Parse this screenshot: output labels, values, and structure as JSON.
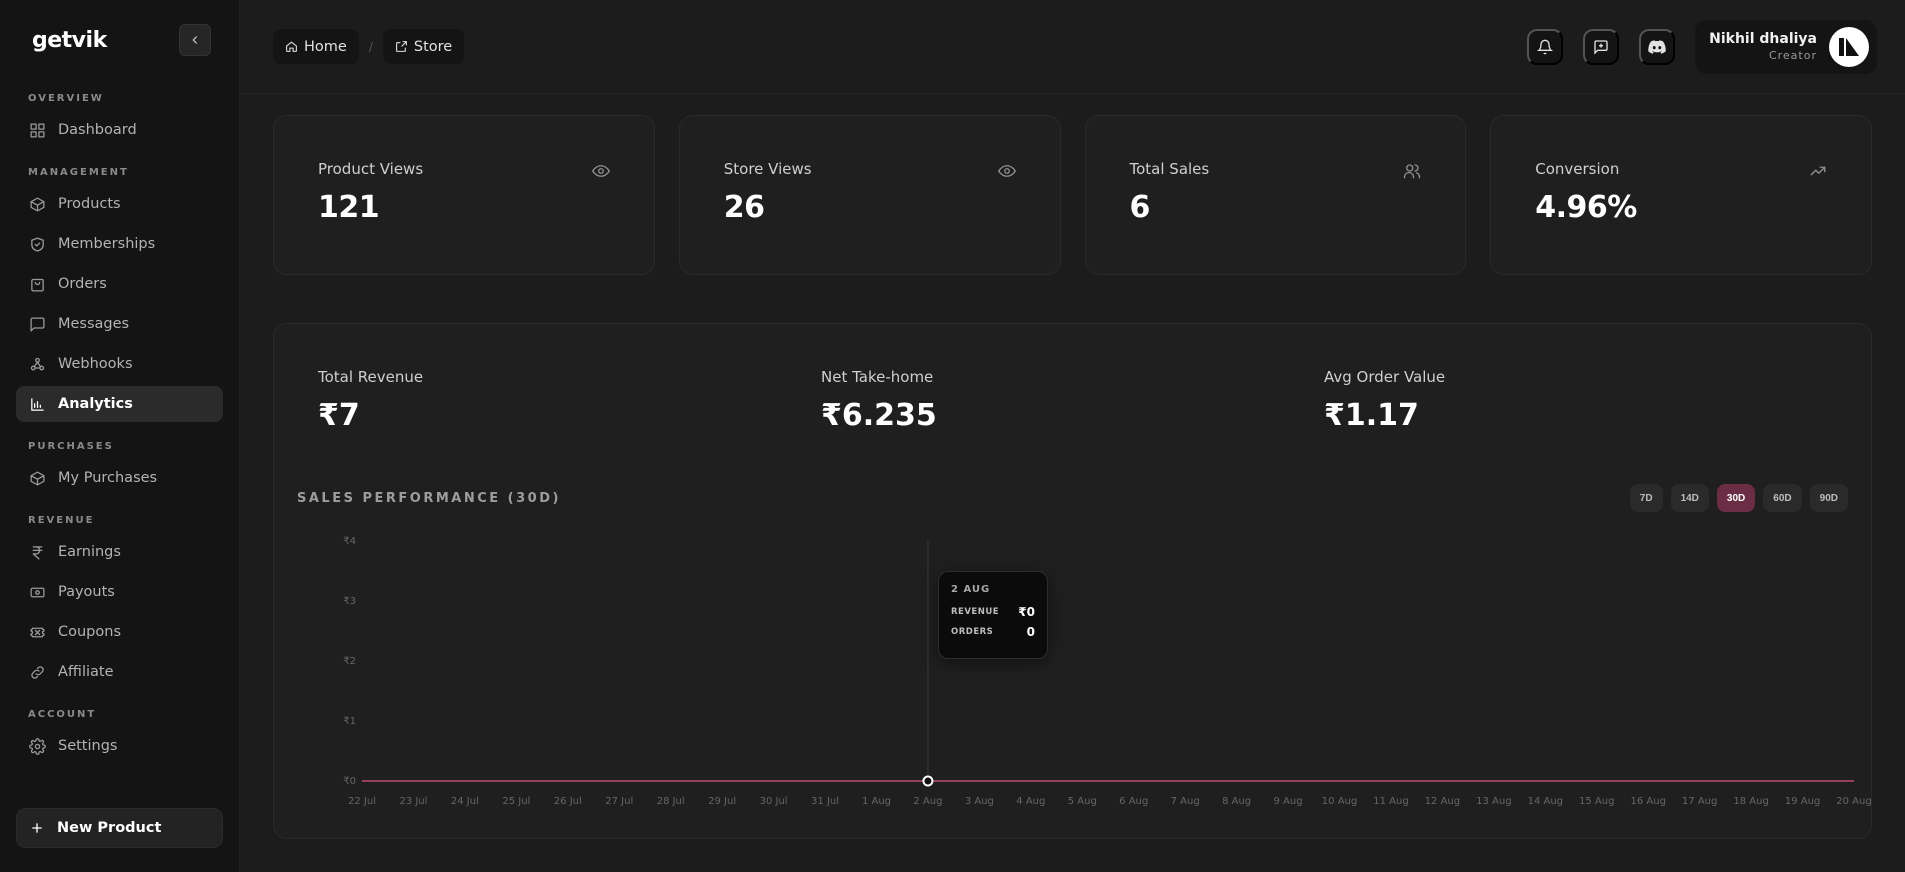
{
  "brand": {
    "name": "getvik"
  },
  "sidebar": {
    "sections": [
      {
        "label": "OVERVIEW",
        "items": [
          {
            "label": "Dashboard",
            "icon": "grid-icon"
          }
        ]
      },
      {
        "label": "MANAGEMENT",
        "items": [
          {
            "label": "Products",
            "icon": "box-icon"
          },
          {
            "label": "Memberships",
            "icon": "shield-icon"
          },
          {
            "label": "Orders",
            "icon": "bag-icon"
          },
          {
            "label": "Messages",
            "icon": "message-icon"
          },
          {
            "label": "Webhooks",
            "icon": "webhook-icon"
          },
          {
            "label": "Analytics",
            "icon": "bar-chart-icon",
            "active": true
          }
        ]
      },
      {
        "label": "PURCHASES",
        "items": [
          {
            "label": "My Purchases",
            "icon": "box-icon"
          }
        ]
      },
      {
        "label": "REVENUE",
        "items": [
          {
            "label": "Earnings",
            "icon": "rupee-icon"
          },
          {
            "label": "Payouts",
            "icon": "cash-icon"
          },
          {
            "label": "Coupons",
            "icon": "ticket-icon"
          },
          {
            "label": "Affiliate",
            "icon": "link-icon"
          }
        ]
      },
      {
        "label": "ACCOUNT",
        "items": [
          {
            "label": "Settings",
            "icon": "gear-icon"
          }
        ]
      }
    ],
    "new_product_label": "New Product"
  },
  "breadcrumb": {
    "home": "Home",
    "store": "Store",
    "sep": "/"
  },
  "user": {
    "name": "Nikhil dhaliya",
    "role": "Creator"
  },
  "stats": [
    {
      "title": "Product Views",
      "value": "121",
      "icon": "eye-icon"
    },
    {
      "title": "Store Views",
      "value": "26",
      "icon": "eye-icon"
    },
    {
      "title": "Total Sales",
      "value": "6",
      "icon": "users-icon"
    },
    {
      "title": "Conversion",
      "value": "4.96%",
      "icon": "trend-up-icon"
    }
  ],
  "revenue": [
    {
      "title": "Total Revenue",
      "value": "₹7"
    },
    {
      "title": "Net Take-home",
      "value": "₹6.235"
    },
    {
      "title": "Avg Order Value",
      "value": "₹1.17"
    }
  ],
  "chart": {
    "title": "SALES PERFORMANCE (30D)",
    "ranges": [
      "7D",
      "14D",
      "30D",
      "60D",
      "90D"
    ],
    "active_range": "30D",
    "tooltip": {
      "date": "2 AUG",
      "revenue_label": "REVENUE",
      "revenue_value": "₹0",
      "orders_label": "ORDERS",
      "orders_value": "0"
    }
  },
  "chart_data": {
    "type": "line",
    "x": [
      "22 Jul",
      "23 Jul",
      "24 Jul",
      "25 Jul",
      "26 Jul",
      "27 Jul",
      "28 Jul",
      "29 Jul",
      "30 Jul",
      "31 Jul",
      "1 Aug",
      "2 Aug",
      "3 Aug",
      "4 Aug",
      "5 Aug",
      "6 Aug",
      "7 Aug",
      "8 Aug",
      "9 Aug",
      "10 Aug",
      "11 Aug",
      "12 Aug",
      "13 Aug",
      "14 Aug",
      "15 Aug",
      "16 Aug",
      "17 Aug",
      "18 Aug",
      "19 Aug",
      "20 Aug"
    ],
    "series": [
      {
        "values": [
          0,
          0,
          0,
          0,
          0,
          0,
          0,
          0,
          0,
          0,
          0,
          0,
          0,
          0,
          0,
          0,
          0,
          0,
          0,
          0,
          0,
          0,
          0,
          0,
          0,
          0,
          0,
          0,
          0,
          0
        ]
      }
    ],
    "yticks": [
      "₹0",
      "₹1",
      "₹2",
      "₹3",
      "₹4"
    ],
    "ylim": [
      0,
      4
    ],
    "highlight_index": 11,
    "line_color": "#c04a6f"
  },
  "colors": {
    "accent": "#6a2d44"
  }
}
